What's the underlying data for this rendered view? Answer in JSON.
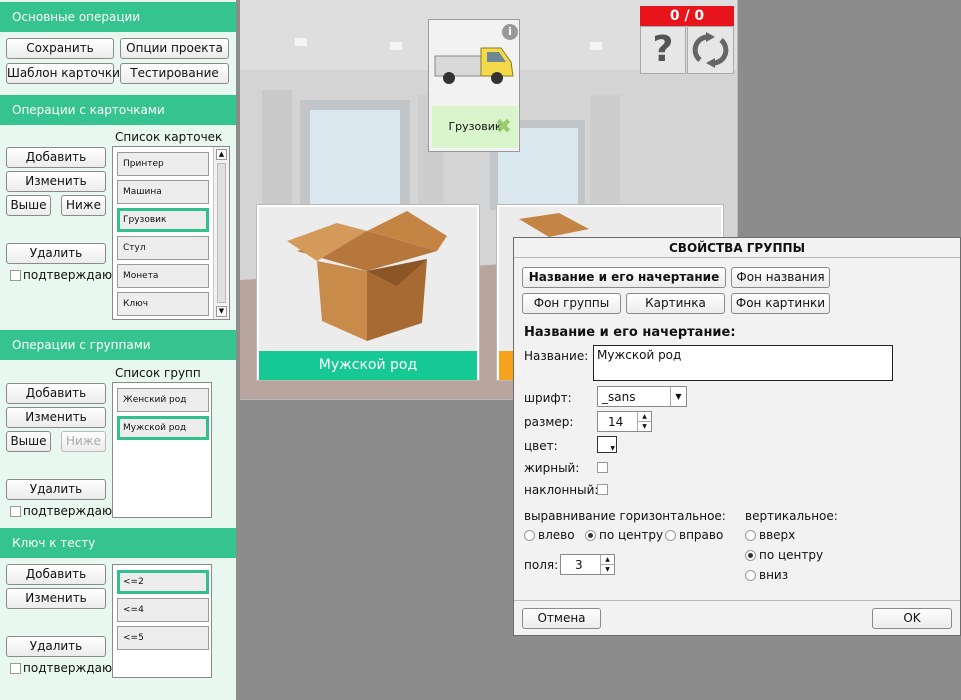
{
  "left_panel": {
    "basic": {
      "title": "Основные операции",
      "save": "Сохранить",
      "project_options": "Опции проекта",
      "card_template": "Шаблон карточки",
      "testing": "Тестирование"
    },
    "cards": {
      "title": "Операции с карточками",
      "list_title": "Список карточек",
      "add": "Добавить",
      "edit": "Изменить",
      "up": "Выше",
      "down": "Ниже",
      "delete": "Удалить",
      "confirm": "подтверждаю",
      "items": [
        "Принтер",
        "Машина",
        "Грузовик",
        "Стул",
        "Монета",
        "Ключ"
      ]
    },
    "groups": {
      "title": "Операции с группами",
      "list_title": "Список групп",
      "add": "Добавить",
      "edit": "Изменить",
      "up": "Выше",
      "down": "Ниже",
      "delete": "Удалить",
      "confirm": "подтверждаю",
      "items": [
        "Женский род",
        "Мужской род"
      ]
    },
    "key": {
      "title": "Ключ к тесту",
      "add": "Добавить",
      "edit": "Изменить",
      "delete": "Удалить",
      "confirm": "подтверждаю",
      "items": [
        "<=2",
        "<=4",
        "<=5"
      ]
    }
  },
  "stage": {
    "score": "0 / 0",
    "card_label": "Грузовик",
    "group_left_label": "Мужской род"
  },
  "dialog": {
    "title": "СВОЙСТВА ГРУППЫ",
    "tabs": [
      "Название и его начертание",
      "Фон названия",
      "Фон группы",
      "Картинка",
      "Фон картинки"
    ],
    "section_title": "Название и его начертание:",
    "name_label": "Название:",
    "name_value": "Мужской род",
    "font_label": "шрифт:",
    "font_value": "_sans",
    "size_label": "размер:",
    "size_value": "14",
    "color_label": "цвет:",
    "bold_label": "жирный:",
    "italic_label": "наклонный:",
    "halign_label": "выравнивание горизонтальное:",
    "halign_options": [
      "влево",
      "по центру",
      "вправо"
    ],
    "valign_label": "вертикальное:",
    "valign_options": [
      "вверх",
      "по центру",
      "вниз"
    ],
    "padding_label": "поля:",
    "padding_value": "3",
    "cancel": "Отмена",
    "ok": "OK"
  },
  "colors": {
    "accent": "#35c48f",
    "score_bg": "#e8141b",
    "group_green": "#16c993",
    "group_orange": "#f6a21c"
  }
}
